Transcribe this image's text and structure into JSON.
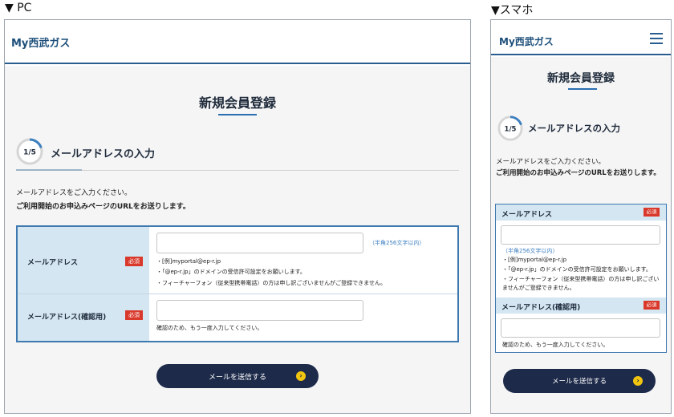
{
  "labels": {
    "pc": "▼ PC",
    "sp": "▼スマホ"
  },
  "brand": "My西武ガス",
  "page_title": "新規会員登録",
  "step": {
    "indicator": "1/5",
    "title": "メールアドレスの入力",
    "progress": 0.2
  },
  "intro": {
    "line1": "メールアドレスをご入力ください。",
    "line2": "ご利用開始のお申込みページのURLをお送りします。"
  },
  "form": {
    "email": {
      "label": "メールアドレス",
      "required": "必須",
      "hint": "（半角256文字以内）",
      "notes": [
        "・[例]myportal@ep-r.jp",
        "・「@ep-r.jp」のドメインの受信許可設定をお願いします。",
        "・フィーチャーフォン（従来型携帯電話）の方は申し訳ございませんがご登録できません。"
      ]
    },
    "confirm": {
      "label": "メールアドレス(確認用)",
      "required": "必須",
      "note": "確認のため、もう一度入力してください。"
    }
  },
  "submit_label": "メールを送信する",
  "colors": {
    "navy": "#1d2a4a",
    "accent_blue": "#2a6db0",
    "required_red": "#d9382a",
    "label_bg": "#d3e6f1",
    "arrow_yellow": "#f1c40f"
  }
}
